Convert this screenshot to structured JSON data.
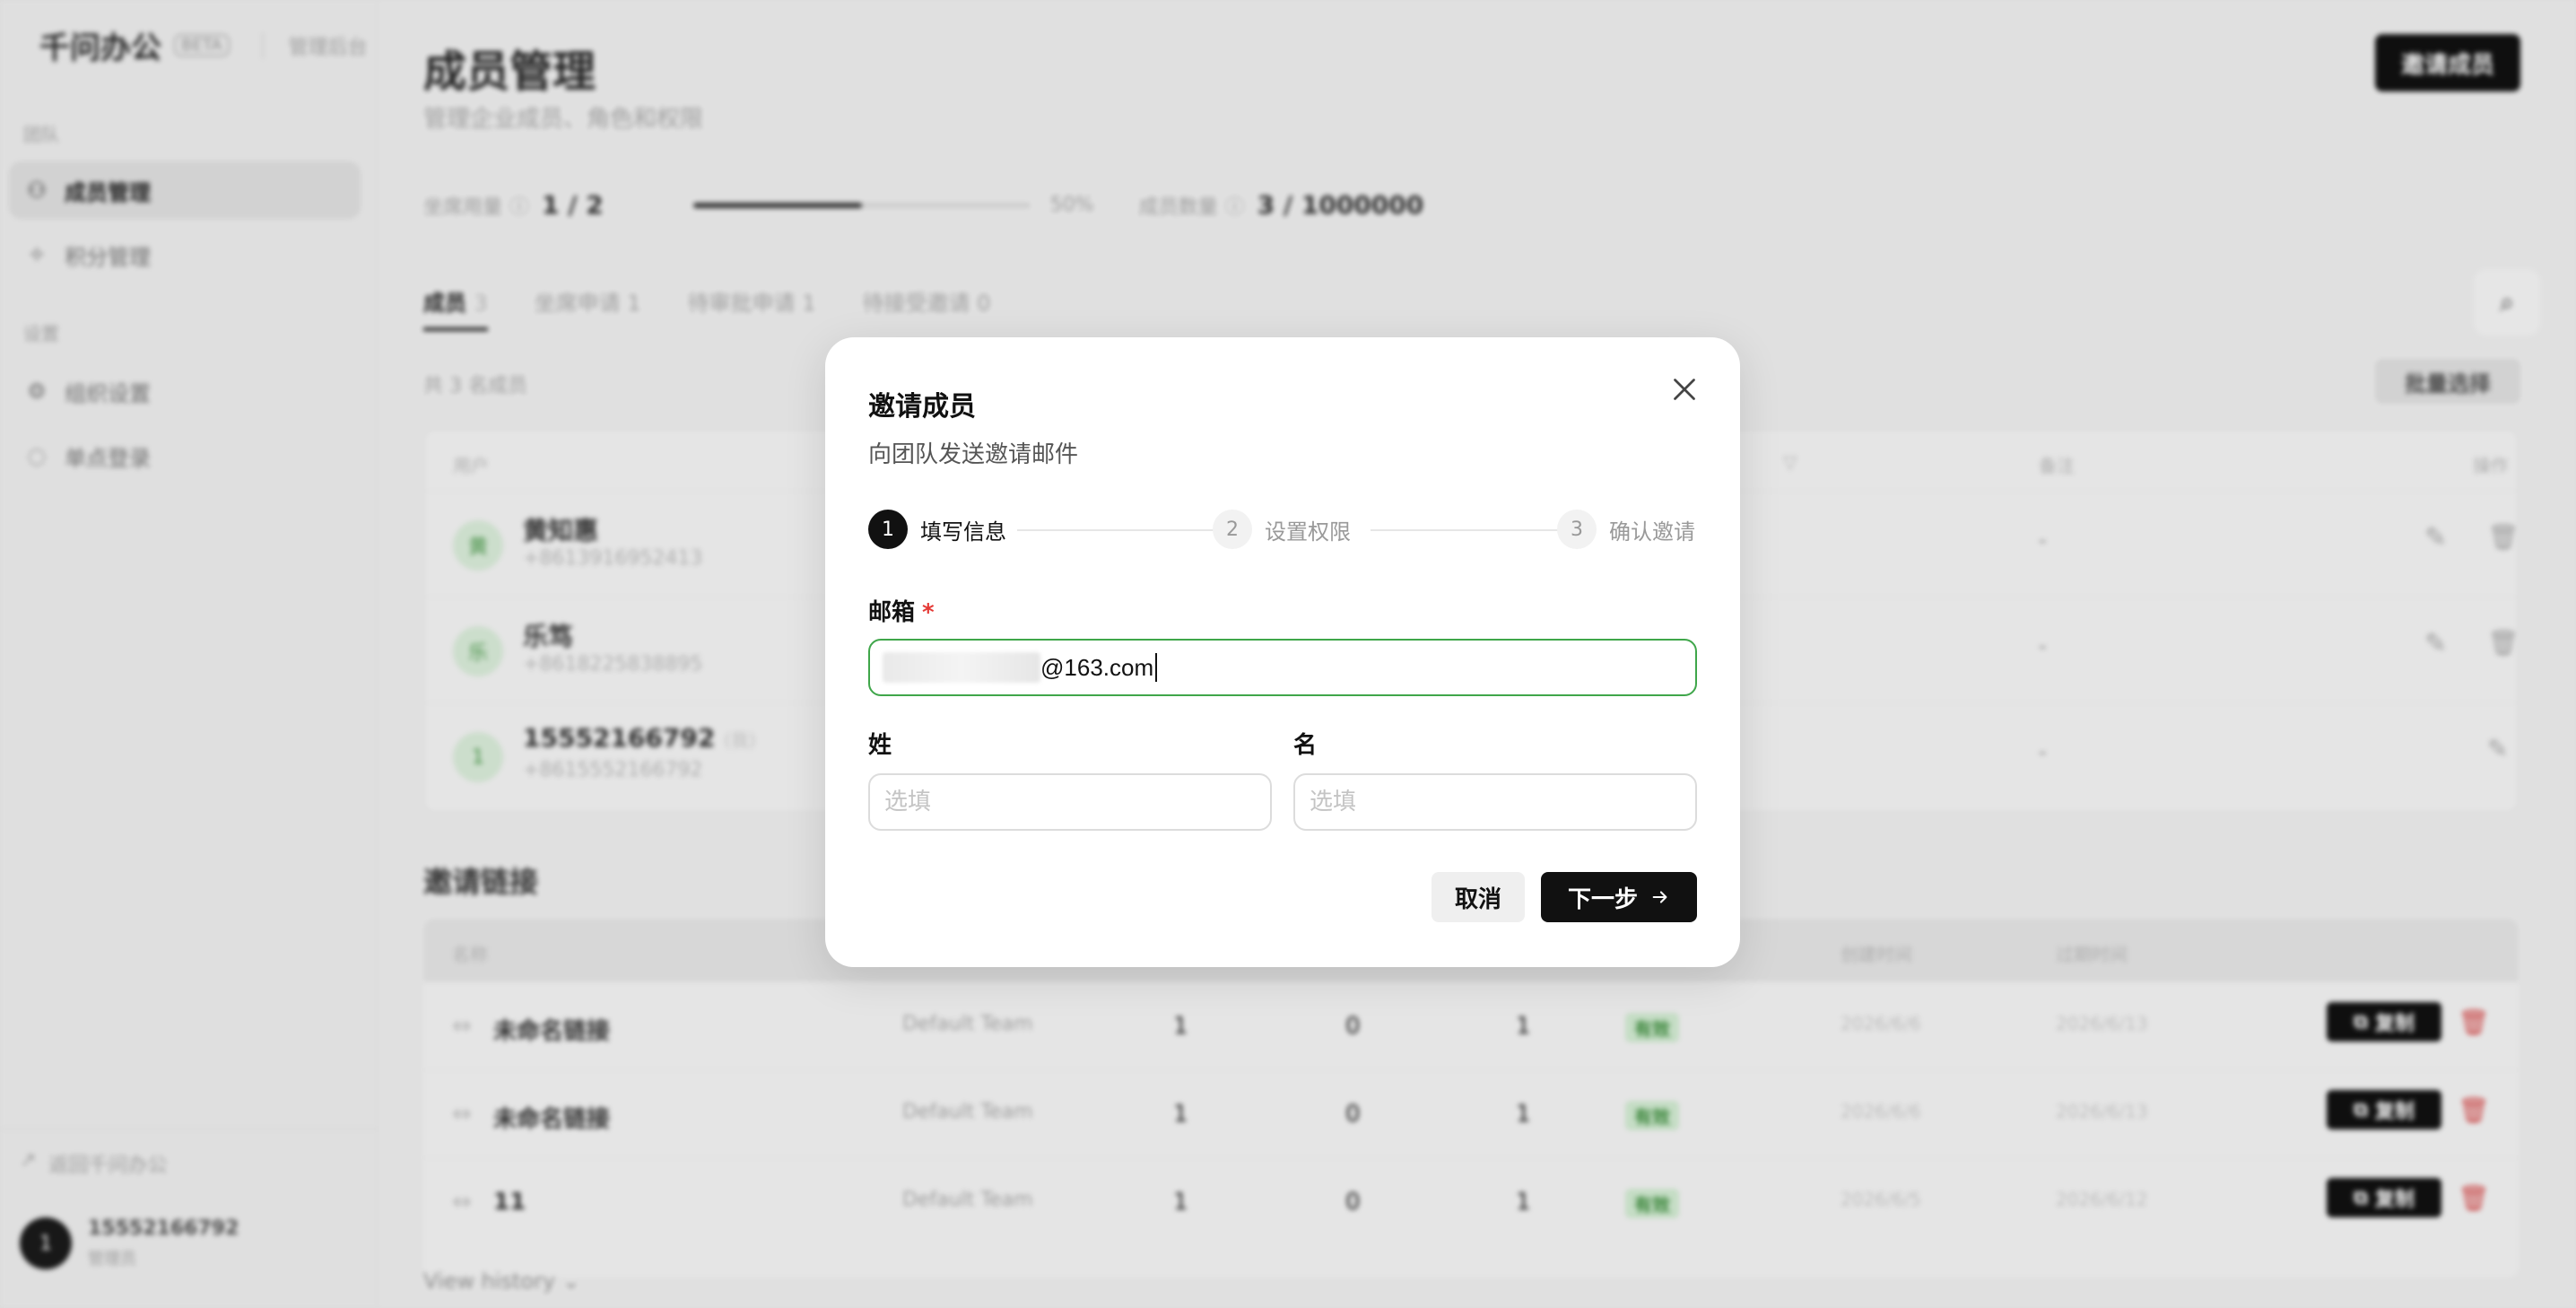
{
  "sidebar": {
    "brand": "千问办公",
    "badge": "BETA",
    "subtitle": "管理后台",
    "group_team": "团队",
    "group_settings": "设置",
    "items": [
      {
        "label": "成员管理",
        "icon": "users-icon"
      },
      {
        "label": "积分管理",
        "icon": "sparkle-icon"
      },
      {
        "label": "组织设置",
        "icon": "gear-icon"
      },
      {
        "label": "单点登录",
        "icon": "key-icon"
      }
    ],
    "back_link": "返回千问办公",
    "user": {
      "avatar_letter": "1",
      "name": "15552166792",
      "role": "管理员"
    }
  },
  "main": {
    "title": "成员管理",
    "subtitle": "管理企业成员、角色和权限",
    "invite_button": "邀请成员",
    "stats": {
      "seat_label": "坐席用量",
      "seat_value": "1 / 2",
      "seat_percent_label": "50%",
      "seat_fraction": 0.5,
      "member_label": "成员数量",
      "member_value": "3 / 1000000"
    },
    "tabs": [
      {
        "label": "成员",
        "count": "3"
      },
      {
        "label": "坐席申请",
        "count": "1"
      },
      {
        "label": "待审批申请",
        "count": "1"
      },
      {
        "label": "待接受邀请",
        "count": "0"
      }
    ],
    "member_count_text": "共 3 名成员",
    "batch_button": "批量选择",
    "table_headers": {
      "user": "用户",
      "remark": "备注",
      "actions": "操作"
    },
    "members": [
      {
        "avatar": "黄",
        "name": "黄知惠",
        "phone": "+8613916952413",
        "tag": "",
        "remark": "-"
      },
      {
        "avatar": "乐",
        "name": "乐笃",
        "phone": "+8618225838895",
        "tag": "",
        "remark": "-"
      },
      {
        "avatar": "1",
        "name": "15552166792",
        "phone": "+8615552166792",
        "tag": "(我)",
        "remark": "-"
      }
    ],
    "links_title": "邀请链接",
    "link_headers": {
      "name": "名称",
      "created": "创建时间",
      "expires": "过期时间"
    },
    "links": [
      {
        "name": "未命名链接",
        "team": "Default Team",
        "c1": "1",
        "c2": "0",
        "c3": "1",
        "status": "有效",
        "created": "2026/6/6",
        "expires": "2026/6/13",
        "copy": "复制"
      },
      {
        "name": "未命名链接",
        "team": "Default Team",
        "c1": "1",
        "c2": "0",
        "c3": "1",
        "status": "有效",
        "created": "2026/6/6",
        "expires": "2026/6/13",
        "copy": "复制"
      },
      {
        "name": "11",
        "team": "Default Team",
        "c1": "1",
        "c2": "0",
        "c3": "1",
        "status": "有效",
        "created": "2026/6/5",
        "expires": "2026/6/12",
        "copy": "复制"
      }
    ],
    "history_link": "View history"
  },
  "modal": {
    "title": "邀请成员",
    "subtitle": "向团队发送邀请邮件",
    "steps": [
      {
        "num": "1",
        "label": "填写信息",
        "state": "active"
      },
      {
        "num": "2",
        "label": "设置权限",
        "state": "idle"
      },
      {
        "num": "3",
        "label": "确认邀请",
        "state": "idle"
      }
    ],
    "email_label": "邮箱",
    "required_mark": "*",
    "email_value_visible": "@163.com",
    "last_name_label": "姓",
    "first_name_label": "名",
    "last_name_placeholder": "选填",
    "first_name_placeholder": "选填",
    "cancel": "取消",
    "next": "下一步",
    "accent_color": "#3fa64a"
  }
}
